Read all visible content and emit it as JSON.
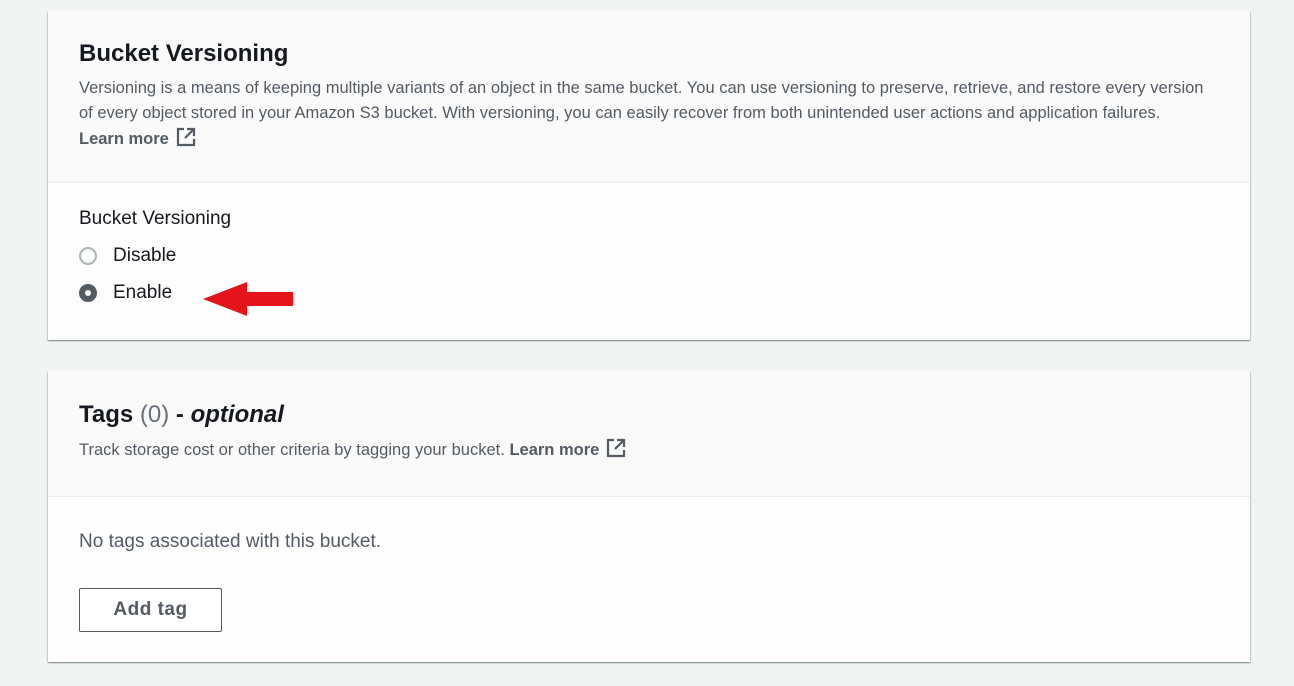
{
  "versioning": {
    "title": "Bucket Versioning",
    "description": "Versioning is a means of keeping multiple variants of an object in the same bucket. You can use versioning to preserve, retrieve, and restore every version of every object stored in your Amazon S3 bucket. With versioning, you can easily recover from both unintended user actions and application failures.",
    "learn_more": "Learn more",
    "field_label": "Bucket Versioning",
    "options": [
      {
        "label": "Disable",
        "selected": false
      },
      {
        "label": "Enable",
        "selected": true
      }
    ]
  },
  "tags": {
    "title": "Tags",
    "count": "(0)",
    "separator": "-",
    "optional": "optional",
    "description": "Track storage cost or other criteria by tagging your bucket.",
    "learn_more": "Learn more",
    "empty_text": "No tags associated with this bucket.",
    "add_button": "Add tag"
  },
  "annotation": {
    "arrow_color": "#e5141a",
    "arrow_icon": "red-arrow-left-icon"
  },
  "colors": {
    "page_bg": "#f2f3f3",
    "panel_bg": "#fdfdfd",
    "text_primary": "#16191f",
    "text_secondary": "#545b64"
  }
}
